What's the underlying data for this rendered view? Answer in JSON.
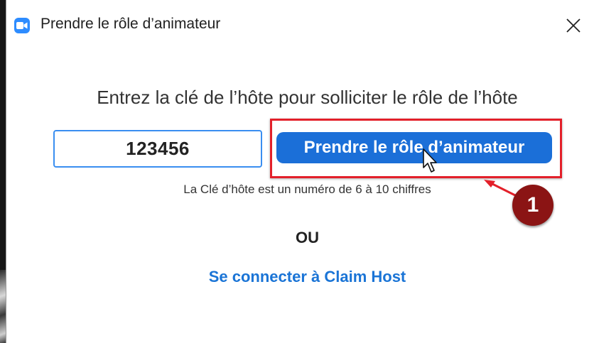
{
  "window": {
    "title": "Prendre le rôle d’animateur",
    "app_icon": "zoom-video-icon",
    "close_icon": "close-icon"
  },
  "dialog": {
    "prompt": "Entrez la clé de l’hôte pour solliciter le rôle de l’hôte",
    "host_key_value": "123456",
    "claim_button_label": "Prendre le rôle d’animateur",
    "hint": "La Clé d’hôte est un numéro de 6 à 10 chiffres",
    "or_label": "OU",
    "claim_host_link": "Se connecter à Claim Host"
  },
  "annotation": {
    "step_number": "1",
    "highlight_color": "#e3202a",
    "badge_color": "#8b1414"
  },
  "colors": {
    "accent": "#1b6fd8",
    "input_border": "#3a8ef0",
    "link": "#1a74d6",
    "zoom_blue": "#2d8cff"
  }
}
